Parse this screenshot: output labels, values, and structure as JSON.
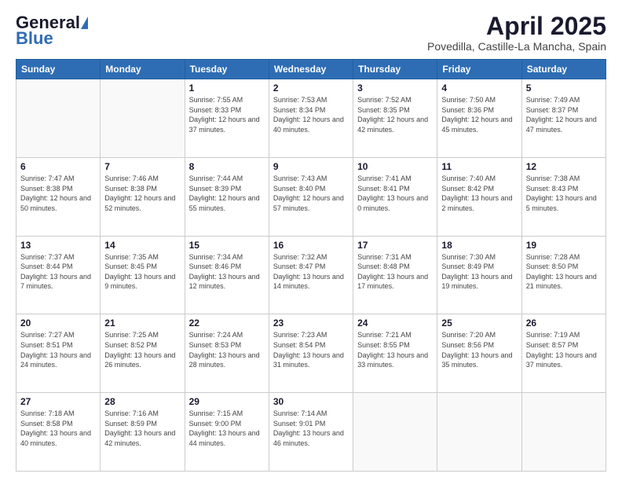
{
  "logo": {
    "general": "General",
    "blue": "Blue"
  },
  "header": {
    "title": "April 2025",
    "subtitle": "Povedilla, Castille-La Mancha, Spain"
  },
  "weekdays": [
    "Sunday",
    "Monday",
    "Tuesday",
    "Wednesday",
    "Thursday",
    "Friday",
    "Saturday"
  ],
  "weeks": [
    [
      {
        "day": "",
        "info": ""
      },
      {
        "day": "",
        "info": ""
      },
      {
        "day": "1",
        "info": "Sunrise: 7:55 AM\nSunset: 8:33 PM\nDaylight: 12 hours and 37 minutes."
      },
      {
        "day": "2",
        "info": "Sunrise: 7:53 AM\nSunset: 8:34 PM\nDaylight: 12 hours and 40 minutes."
      },
      {
        "day": "3",
        "info": "Sunrise: 7:52 AM\nSunset: 8:35 PM\nDaylight: 12 hours and 42 minutes."
      },
      {
        "day": "4",
        "info": "Sunrise: 7:50 AM\nSunset: 8:36 PM\nDaylight: 12 hours and 45 minutes."
      },
      {
        "day": "5",
        "info": "Sunrise: 7:49 AM\nSunset: 8:37 PM\nDaylight: 12 hours and 47 minutes."
      }
    ],
    [
      {
        "day": "6",
        "info": "Sunrise: 7:47 AM\nSunset: 8:38 PM\nDaylight: 12 hours and 50 minutes."
      },
      {
        "day": "7",
        "info": "Sunrise: 7:46 AM\nSunset: 8:38 PM\nDaylight: 12 hours and 52 minutes."
      },
      {
        "day": "8",
        "info": "Sunrise: 7:44 AM\nSunset: 8:39 PM\nDaylight: 12 hours and 55 minutes."
      },
      {
        "day": "9",
        "info": "Sunrise: 7:43 AM\nSunset: 8:40 PM\nDaylight: 12 hours and 57 minutes."
      },
      {
        "day": "10",
        "info": "Sunrise: 7:41 AM\nSunset: 8:41 PM\nDaylight: 13 hours and 0 minutes."
      },
      {
        "day": "11",
        "info": "Sunrise: 7:40 AM\nSunset: 8:42 PM\nDaylight: 13 hours and 2 minutes."
      },
      {
        "day": "12",
        "info": "Sunrise: 7:38 AM\nSunset: 8:43 PM\nDaylight: 13 hours and 5 minutes."
      }
    ],
    [
      {
        "day": "13",
        "info": "Sunrise: 7:37 AM\nSunset: 8:44 PM\nDaylight: 13 hours and 7 minutes."
      },
      {
        "day": "14",
        "info": "Sunrise: 7:35 AM\nSunset: 8:45 PM\nDaylight: 13 hours and 9 minutes."
      },
      {
        "day": "15",
        "info": "Sunrise: 7:34 AM\nSunset: 8:46 PM\nDaylight: 13 hours and 12 minutes."
      },
      {
        "day": "16",
        "info": "Sunrise: 7:32 AM\nSunset: 8:47 PM\nDaylight: 13 hours and 14 minutes."
      },
      {
        "day": "17",
        "info": "Sunrise: 7:31 AM\nSunset: 8:48 PM\nDaylight: 13 hours and 17 minutes."
      },
      {
        "day": "18",
        "info": "Sunrise: 7:30 AM\nSunset: 8:49 PM\nDaylight: 13 hours and 19 minutes."
      },
      {
        "day": "19",
        "info": "Sunrise: 7:28 AM\nSunset: 8:50 PM\nDaylight: 13 hours and 21 minutes."
      }
    ],
    [
      {
        "day": "20",
        "info": "Sunrise: 7:27 AM\nSunset: 8:51 PM\nDaylight: 13 hours and 24 minutes."
      },
      {
        "day": "21",
        "info": "Sunrise: 7:25 AM\nSunset: 8:52 PM\nDaylight: 13 hours and 26 minutes."
      },
      {
        "day": "22",
        "info": "Sunrise: 7:24 AM\nSunset: 8:53 PM\nDaylight: 13 hours and 28 minutes."
      },
      {
        "day": "23",
        "info": "Sunrise: 7:23 AM\nSunset: 8:54 PM\nDaylight: 13 hours and 31 minutes."
      },
      {
        "day": "24",
        "info": "Sunrise: 7:21 AM\nSunset: 8:55 PM\nDaylight: 13 hours and 33 minutes."
      },
      {
        "day": "25",
        "info": "Sunrise: 7:20 AM\nSunset: 8:56 PM\nDaylight: 13 hours and 35 minutes."
      },
      {
        "day": "26",
        "info": "Sunrise: 7:19 AM\nSunset: 8:57 PM\nDaylight: 13 hours and 37 minutes."
      }
    ],
    [
      {
        "day": "27",
        "info": "Sunrise: 7:18 AM\nSunset: 8:58 PM\nDaylight: 13 hours and 40 minutes."
      },
      {
        "day": "28",
        "info": "Sunrise: 7:16 AM\nSunset: 8:59 PM\nDaylight: 13 hours and 42 minutes."
      },
      {
        "day": "29",
        "info": "Sunrise: 7:15 AM\nSunset: 9:00 PM\nDaylight: 13 hours and 44 minutes."
      },
      {
        "day": "30",
        "info": "Sunrise: 7:14 AM\nSunset: 9:01 PM\nDaylight: 13 hours and 46 minutes."
      },
      {
        "day": "",
        "info": ""
      },
      {
        "day": "",
        "info": ""
      },
      {
        "day": "",
        "info": ""
      }
    ]
  ]
}
